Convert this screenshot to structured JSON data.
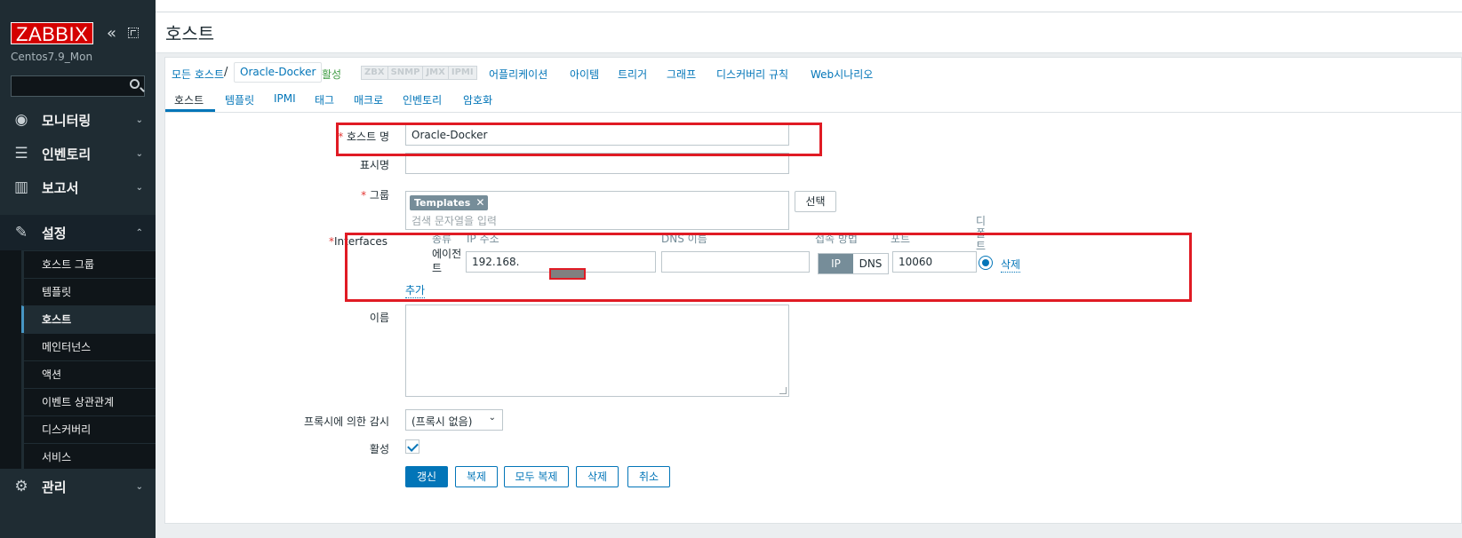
{
  "sidebar": {
    "logo": "ZABBIX",
    "collapse_icon": "«",
    "server_name": "Centos7.9_Mon",
    "menu": [
      {
        "label": "모니터링",
        "icon": "eye-icon"
      },
      {
        "label": "인벤토리",
        "icon": "list-icon"
      },
      {
        "label": "보고서",
        "icon": "bar-chart-icon"
      },
      {
        "label": "설정",
        "icon": "wrench-icon"
      },
      {
        "label": "관리",
        "icon": "gear-icon"
      }
    ],
    "submenu": [
      "호스트 그룹",
      "템플릿",
      "호스트",
      "메인터넌스",
      "액션",
      "이벤트 상관관계",
      "디스커버리",
      "서비스"
    ],
    "chev_down": "⌄",
    "chev_up": "⌃"
  },
  "header": {
    "title": "호스트"
  },
  "nav": {
    "all_hosts": "모든 호스트",
    "sep": "/",
    "current_host": "Oracle-Docker",
    "status": "활성",
    "availability": [
      "ZBX",
      "SNMP",
      "JMX",
      "IPMI"
    ],
    "links": [
      "어플리케이션",
      "아이템",
      "트리거",
      "그래프",
      "디스커버리 규칙",
      "Web시나리오"
    ]
  },
  "tabs": [
    "호스트",
    "템플릿",
    "IPMI",
    "태그",
    "매크로",
    "인벤토리",
    "암호화"
  ],
  "form": {
    "required_mark": "*",
    "host_name_label": "호스트 명",
    "host_name_value": "Oracle-Docker",
    "visible_name_label": "표시명",
    "visible_name_value": "",
    "groups_label": "그룹",
    "group_chip": "Templates",
    "chip_remove": "✕",
    "groups_placeholder": "검색 문자열을 입력",
    "select_button": "선택",
    "interfaces_label": "Interfaces",
    "iface_headers": {
      "type": "종류",
      "ip": "IP 주소",
      "dns": "DNS 이름",
      "connect": "접속 방법",
      "port": "포트",
      "default": "디폴트"
    },
    "iface_type": "에이전트",
    "iface_ip": "192.168.",
    "iface_dns": "",
    "iface_connect_ip": "IP",
    "iface_connect_dns": "DNS",
    "iface_port": "10060",
    "iface_remove": "삭제",
    "add_link": "추가",
    "description_label": "이름",
    "proxy_label": "프록시에 의한 감시",
    "proxy_value": "(프록시 없음)",
    "enabled_label": "활성",
    "buttons": {
      "update": "갱신",
      "clone": "복제",
      "full_clone": "모두 복제",
      "delete": "삭제",
      "cancel": "취소"
    }
  },
  "colors": {
    "accent": "#0275b8",
    "sidebar": "#1f2c33",
    "logo": "#d40000",
    "highlight": "#e01b24"
  }
}
